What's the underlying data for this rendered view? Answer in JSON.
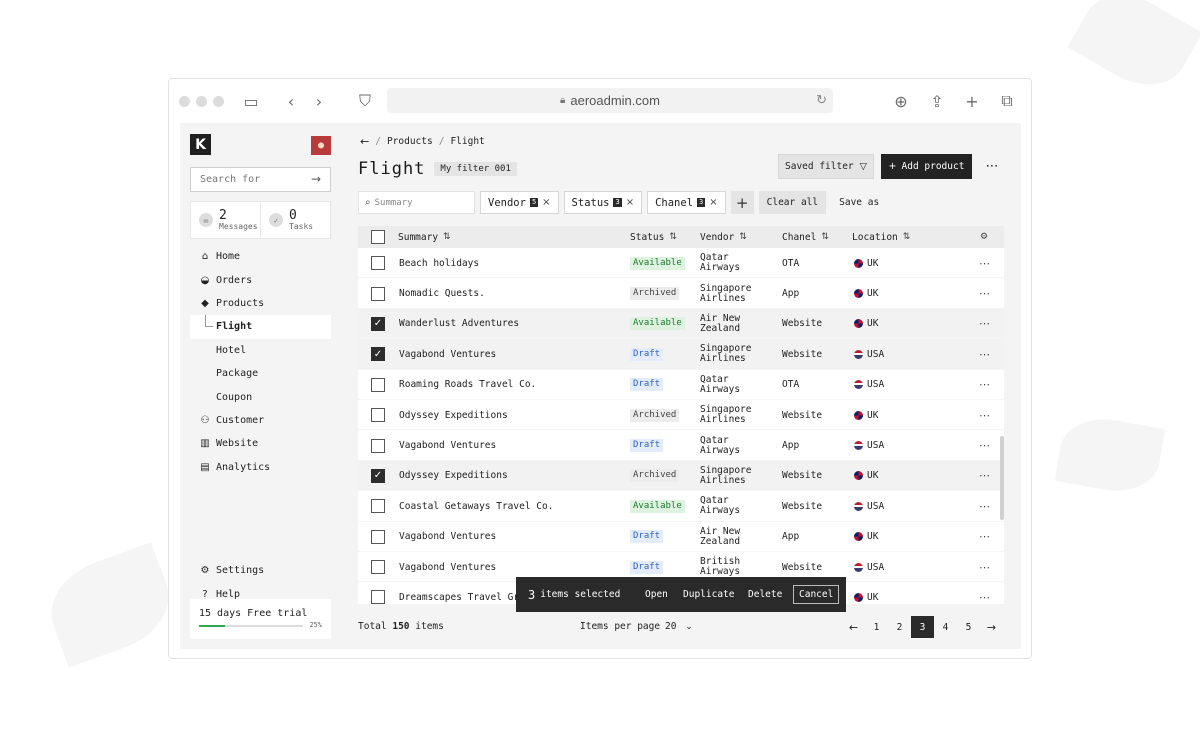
{
  "browser": {
    "url": "aeroadmin.com"
  },
  "sidebar": {
    "logo": "K",
    "search_placeholder": "Search for",
    "stats": [
      {
        "value": "2",
        "label": "Messages"
      },
      {
        "value": "0",
        "label": "Tasks"
      }
    ],
    "nav": [
      {
        "label": "Home",
        "icon": "home-icon"
      },
      {
        "label": "Orders",
        "icon": "basket-icon"
      },
      {
        "label": "Products",
        "icon": "tag-icon"
      },
      {
        "label": "Flight",
        "sub": true,
        "active": true
      },
      {
        "label": "Hotel",
        "sub": true
      },
      {
        "label": "Package",
        "sub": true
      },
      {
        "label": "Coupon",
        "sub": true
      },
      {
        "label": "Customer",
        "icon": "users-icon"
      },
      {
        "label": "Website",
        "icon": "store-icon"
      },
      {
        "label": "Analytics",
        "icon": "chart-icon"
      }
    ],
    "bottom_nav": [
      {
        "label": "Settings",
        "icon": "gear-icon"
      },
      {
        "label": "Help",
        "icon": "help-icon"
      }
    ],
    "trial": {
      "label": "15 days Free trial",
      "percent_label": "25%",
      "progress": 0.25
    }
  },
  "main": {
    "breadcrumb": [
      "Products",
      "Flight"
    ],
    "title": "Flight",
    "filter_name": "My filter 001",
    "saved_filter_label": "Saved filter",
    "add_product_label": "Add product",
    "summary_placeholder": "Summary",
    "chips": [
      {
        "label": "Vendor",
        "count": "5"
      },
      {
        "label": "Status",
        "count": "3"
      },
      {
        "label": "Chanel",
        "count": "3"
      }
    ],
    "clear_all_label": "Clear all",
    "save_as_label": "Save as",
    "columns": [
      "Summary",
      "Status",
      "Vendor",
      "Chanel",
      "Location"
    ],
    "rows": [
      {
        "summary": "Beach holidays",
        "status": "Available",
        "vendor": [
          "Qatar",
          "Airways"
        ],
        "chanel": "OTA",
        "location": "UK",
        "checked": false
      },
      {
        "summary": "Nomadic Quests.",
        "status": "Archived",
        "vendor": [
          "Singapore",
          "Airlines"
        ],
        "chanel": "App",
        "location": "UK",
        "checked": false
      },
      {
        "summary": "Wanderlust Adventures",
        "status": "Available",
        "vendor": [
          "Air New",
          "Zealand"
        ],
        "chanel": "Website",
        "location": "UK",
        "checked": true
      },
      {
        "summary": "Vagabond Ventures",
        "status": "Draft",
        "vendor": [
          "Singapore",
          "Airlines"
        ],
        "chanel": "Website",
        "location": "USA",
        "checked": true
      },
      {
        "summary": "Roaming Roads Travel Co.",
        "status": "Draft",
        "vendor": [
          "Qatar",
          "Airways"
        ],
        "chanel": "OTA",
        "location": "USA",
        "checked": false
      },
      {
        "summary": "Odyssey Expeditions",
        "status": "Archived",
        "vendor": [
          "Singapore",
          "Airlines"
        ],
        "chanel": "Website",
        "location": "UK",
        "checked": false
      },
      {
        "summary": "Vagabond Ventures",
        "status": "Draft",
        "vendor": [
          "Qatar",
          "Airways"
        ],
        "chanel": "App",
        "location": "USA",
        "checked": false
      },
      {
        "summary": "Odyssey Expeditions",
        "status": "Archived",
        "vendor": [
          "Singapore",
          "Airlines"
        ],
        "chanel": "Website",
        "location": "UK",
        "checked": true
      },
      {
        "summary": "Coastal Getaways Travel Co.",
        "status": "Available",
        "vendor": [
          "Qatar",
          "Airways"
        ],
        "chanel": "Website",
        "location": "USA",
        "checked": false
      },
      {
        "summary": "Vagabond Ventures",
        "status": "Draft",
        "vendor": [
          "Air New",
          "Zealand"
        ],
        "chanel": "App",
        "location": "UK",
        "checked": false
      },
      {
        "summary": "Vagabond Ventures",
        "status": "Draft",
        "vendor": [
          "British",
          "Airways"
        ],
        "chanel": "Website",
        "location": "USA",
        "checked": false
      },
      {
        "summary": "Dreamscapes Travel Gro",
        "status": "",
        "vendor": [
          "",
          ""
        ],
        "chanel": "",
        "location": "UK",
        "checked": false
      }
    ],
    "selection_bar": {
      "count": "3",
      "label": "items selected",
      "actions": [
        "Open",
        "Duplicate",
        "Delete"
      ],
      "cancel": "Cancel"
    },
    "footer": {
      "total_prefix": "Total",
      "total_value": "150",
      "total_suffix": "items",
      "items_per_page_label": "Items per page",
      "items_per_page_value": "20",
      "pages": [
        "1",
        "2",
        "3",
        "4",
        "5"
      ],
      "current_page": "3"
    }
  }
}
